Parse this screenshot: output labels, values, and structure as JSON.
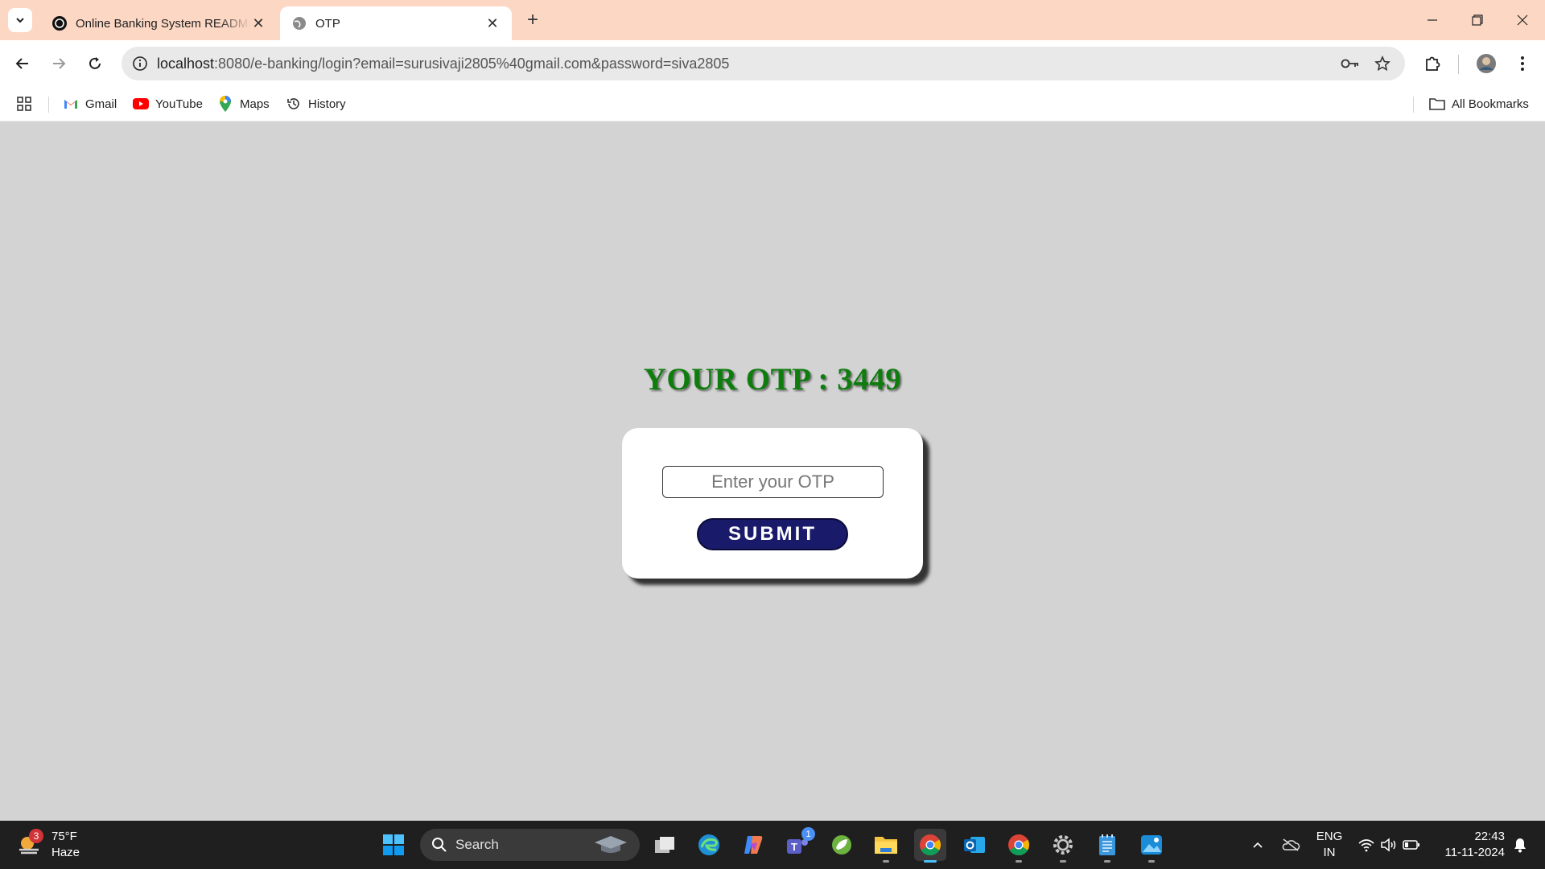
{
  "browser": {
    "tabs": [
      {
        "title": "Online Banking System README",
        "active": false
      },
      {
        "title": "OTP",
        "active": true
      }
    ],
    "url": {
      "host": "localhost",
      "rest": ":8080/e-banking/login?email=surusivaji2805%40gmail.com&password=siva2805"
    },
    "bookmarks": [
      {
        "label": "Gmail",
        "icon": "gmail-icon"
      },
      {
        "label": "YouTube",
        "icon": "youtube-icon"
      },
      {
        "label": "Maps",
        "icon": "maps-icon"
      },
      {
        "label": "History",
        "icon": "history-icon"
      }
    ],
    "all_bookmarks_label": "All Bookmarks"
  },
  "page": {
    "otp_heading": "YOUR OTP : 3449",
    "otp_input_placeholder": "Enter your OTP",
    "otp_input_value": "",
    "submit_label": "SUBMIT"
  },
  "taskbar": {
    "weather": {
      "temp": "75°F",
      "condition": "Haze",
      "badge": "3"
    },
    "search_label": "Search",
    "teams_badge": "1",
    "language": {
      "line1": "ENG",
      "line2": "IN"
    },
    "clock": {
      "time": "22:43",
      "date": "11-11-2024"
    }
  },
  "colors": {
    "tabstrip": "#fcd7c4",
    "page_background": "#d3d3d3",
    "otp_heading": "#0e7d0e",
    "submit_button": "#1a1a6b"
  }
}
